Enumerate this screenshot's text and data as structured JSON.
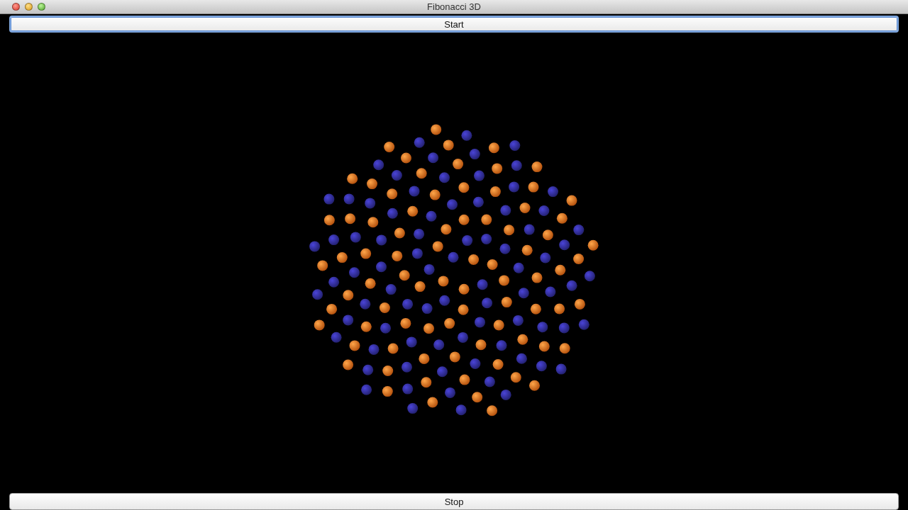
{
  "window": {
    "title": "Fibonacci 3D"
  },
  "top_button": {
    "label": "Start",
    "focused": true
  },
  "bottom_button": {
    "label": "Stop",
    "focused": false
  }
}
